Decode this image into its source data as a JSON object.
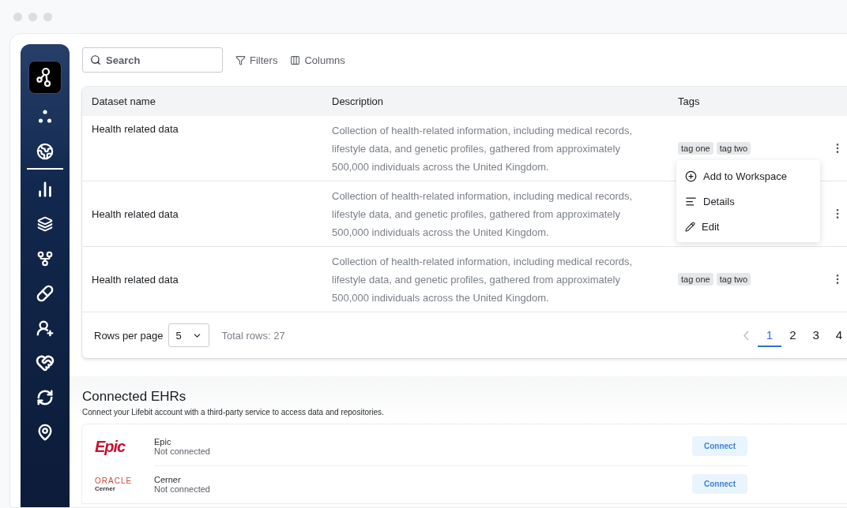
{
  "sidebar": {
    "items": [
      {
        "selected": false
      },
      {
        "selected": true
      },
      {
        "selected": false
      },
      {
        "selected": false
      },
      {
        "selected": false
      },
      {
        "selected": false
      },
      {
        "selected": false
      },
      {
        "selected": false
      },
      {
        "selected": false
      },
      {
        "selected": false
      }
    ]
  },
  "toolbar": {
    "search": {
      "placeholder": "Search"
    },
    "buttons": [
      "Filters",
      "Columns"
    ]
  },
  "table": {
    "columns": [
      "Dataset name",
      "Description",
      "Tags"
    ],
    "rows": [
      {
        "name": "Health related data",
        "description": "Collection of health-related information, including medical records, lifestyle data, and genetic profiles, gathered from approximately 500,000 individuals across the United Kingdom.",
        "tags": [
          "tag one",
          "tag two"
        ],
        "menu": {
          "items": [
            "Add to Workspace",
            "Details",
            "Edit"
          ]
        }
      },
      {
        "name": "Health related data",
        "description": "Collection of health-related information, including medical records, lifestyle data, and genetic profiles, gathered from approximately 500,000 individuals across the United Kingdom."
      },
      {
        "name": "Health related data",
        "description": "Collection of health-related information, including medical records, lifestyle data, and genetic profiles, gathered from approximately 500,000 individuals across the United Kingdom.",
        "tags": [
          "tag one",
          "tag two"
        ]
      }
    ],
    "footer": {
      "rows_per_page_label": "Rows per page",
      "rows_per_page": "5",
      "total": "Total rows: 27",
      "pages": [
        {
          "label": "1",
          "selected": true
        },
        {
          "label": "2",
          "selected": false
        },
        {
          "label": "3",
          "selected": false
        },
        {
          "label": "4",
          "selected": false
        }
      ]
    }
  },
  "ehrs": {
    "title": "Connected EHRs",
    "subtitle": "Connect your Lifebit account with a third-party service to access data and repositories.",
    "items": [
      {
        "kind": "epic",
        "logo": [
          "Epic"
        ],
        "name": "Epic",
        "status": "Not connected",
        "button": "Connect"
      },
      {
        "kind": "oracle",
        "logo": [
          "ORACLE",
          "Cerner"
        ],
        "name": "Cerner",
        "status": "Not connected",
        "button": "Connect"
      }
    ]
  }
}
